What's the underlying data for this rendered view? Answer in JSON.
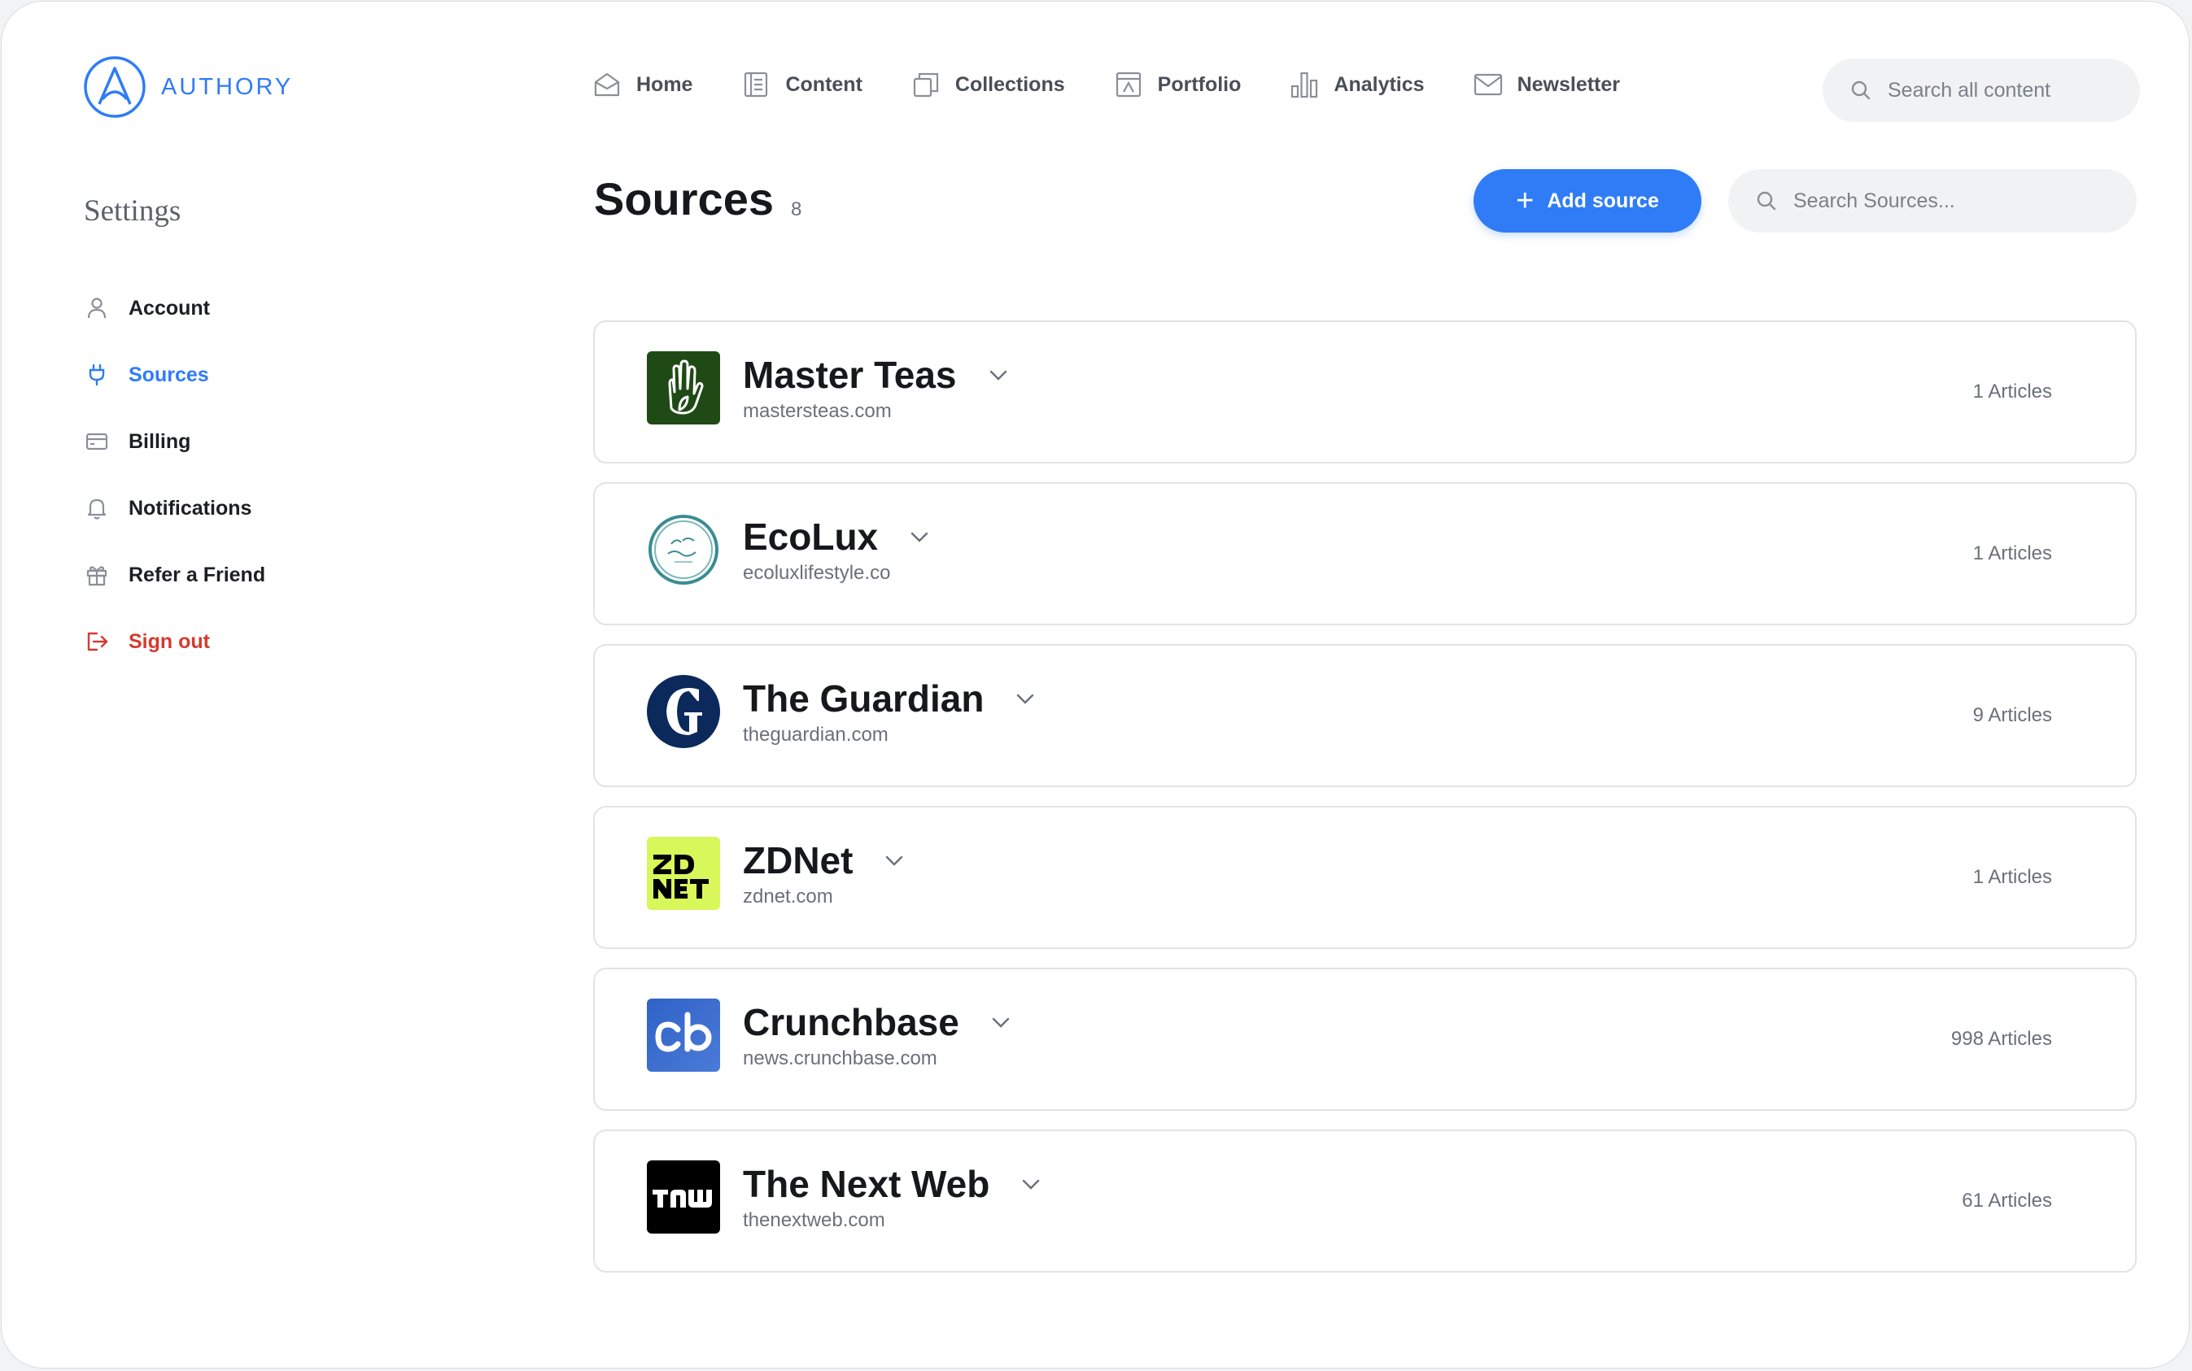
{
  "app": {
    "brand": "AUTHORY",
    "accent": "#2f7cf6"
  },
  "topnav": {
    "items": [
      {
        "label": "Home",
        "icon": "home-icon"
      },
      {
        "label": "Content",
        "icon": "content-icon"
      },
      {
        "label": "Collections",
        "icon": "collections-icon"
      },
      {
        "label": "Portfolio",
        "icon": "portfolio-icon"
      },
      {
        "label": "Analytics",
        "icon": "analytics-icon"
      },
      {
        "label": "Newsletter",
        "icon": "newsletter-icon"
      }
    ],
    "search_placeholder": "Search all content"
  },
  "sidebar": {
    "title": "Settings",
    "items": [
      {
        "label": "Account",
        "icon": "user-icon",
        "state": "default"
      },
      {
        "label": "Sources",
        "icon": "plug-icon",
        "state": "active"
      },
      {
        "label": "Billing",
        "icon": "credit-card-icon",
        "state": "default"
      },
      {
        "label": "Notifications",
        "icon": "bell-icon",
        "state": "default"
      },
      {
        "label": "Refer a Friend",
        "icon": "gift-icon",
        "state": "default"
      },
      {
        "label": "Sign out",
        "icon": "sign-out-icon",
        "state": "danger"
      }
    ]
  },
  "main": {
    "title": "Sources",
    "count": "8",
    "add_button_label": "Add source",
    "search_placeholder": "Search Sources...",
    "sources": [
      {
        "name": "Master Teas",
        "domain": "mastersteas.com",
        "articles": "1 Articles",
        "logo": "hand-leaf-logo",
        "logo_bg": "#1f4a15"
      },
      {
        "name": "EcoLux",
        "domain": "ecoluxlifestyle.co",
        "articles": "1 Articles",
        "logo": "ecolux-wreath-logo",
        "logo_bg": "#ffffff"
      },
      {
        "name": "The Guardian",
        "domain": "theguardian.com",
        "articles": "9 Articles",
        "logo": "guardian-g-logo",
        "logo_bg": "#0b2a5b"
      },
      {
        "name": "ZDNet",
        "domain": "zdnet.com",
        "articles": "1 Articles",
        "logo": "zdnet-logo",
        "logo_bg": "#d7f75b"
      },
      {
        "name": "Crunchbase",
        "domain": "news.crunchbase.com",
        "articles": "998 Articles",
        "logo": "crunchbase-cb-logo",
        "logo_bg": "#2f62c7"
      },
      {
        "name": "The Next Web",
        "domain": "thenextweb.com",
        "articles": "61 Articles",
        "logo": "tnw-logo",
        "logo_bg": "#000000"
      }
    ]
  }
}
